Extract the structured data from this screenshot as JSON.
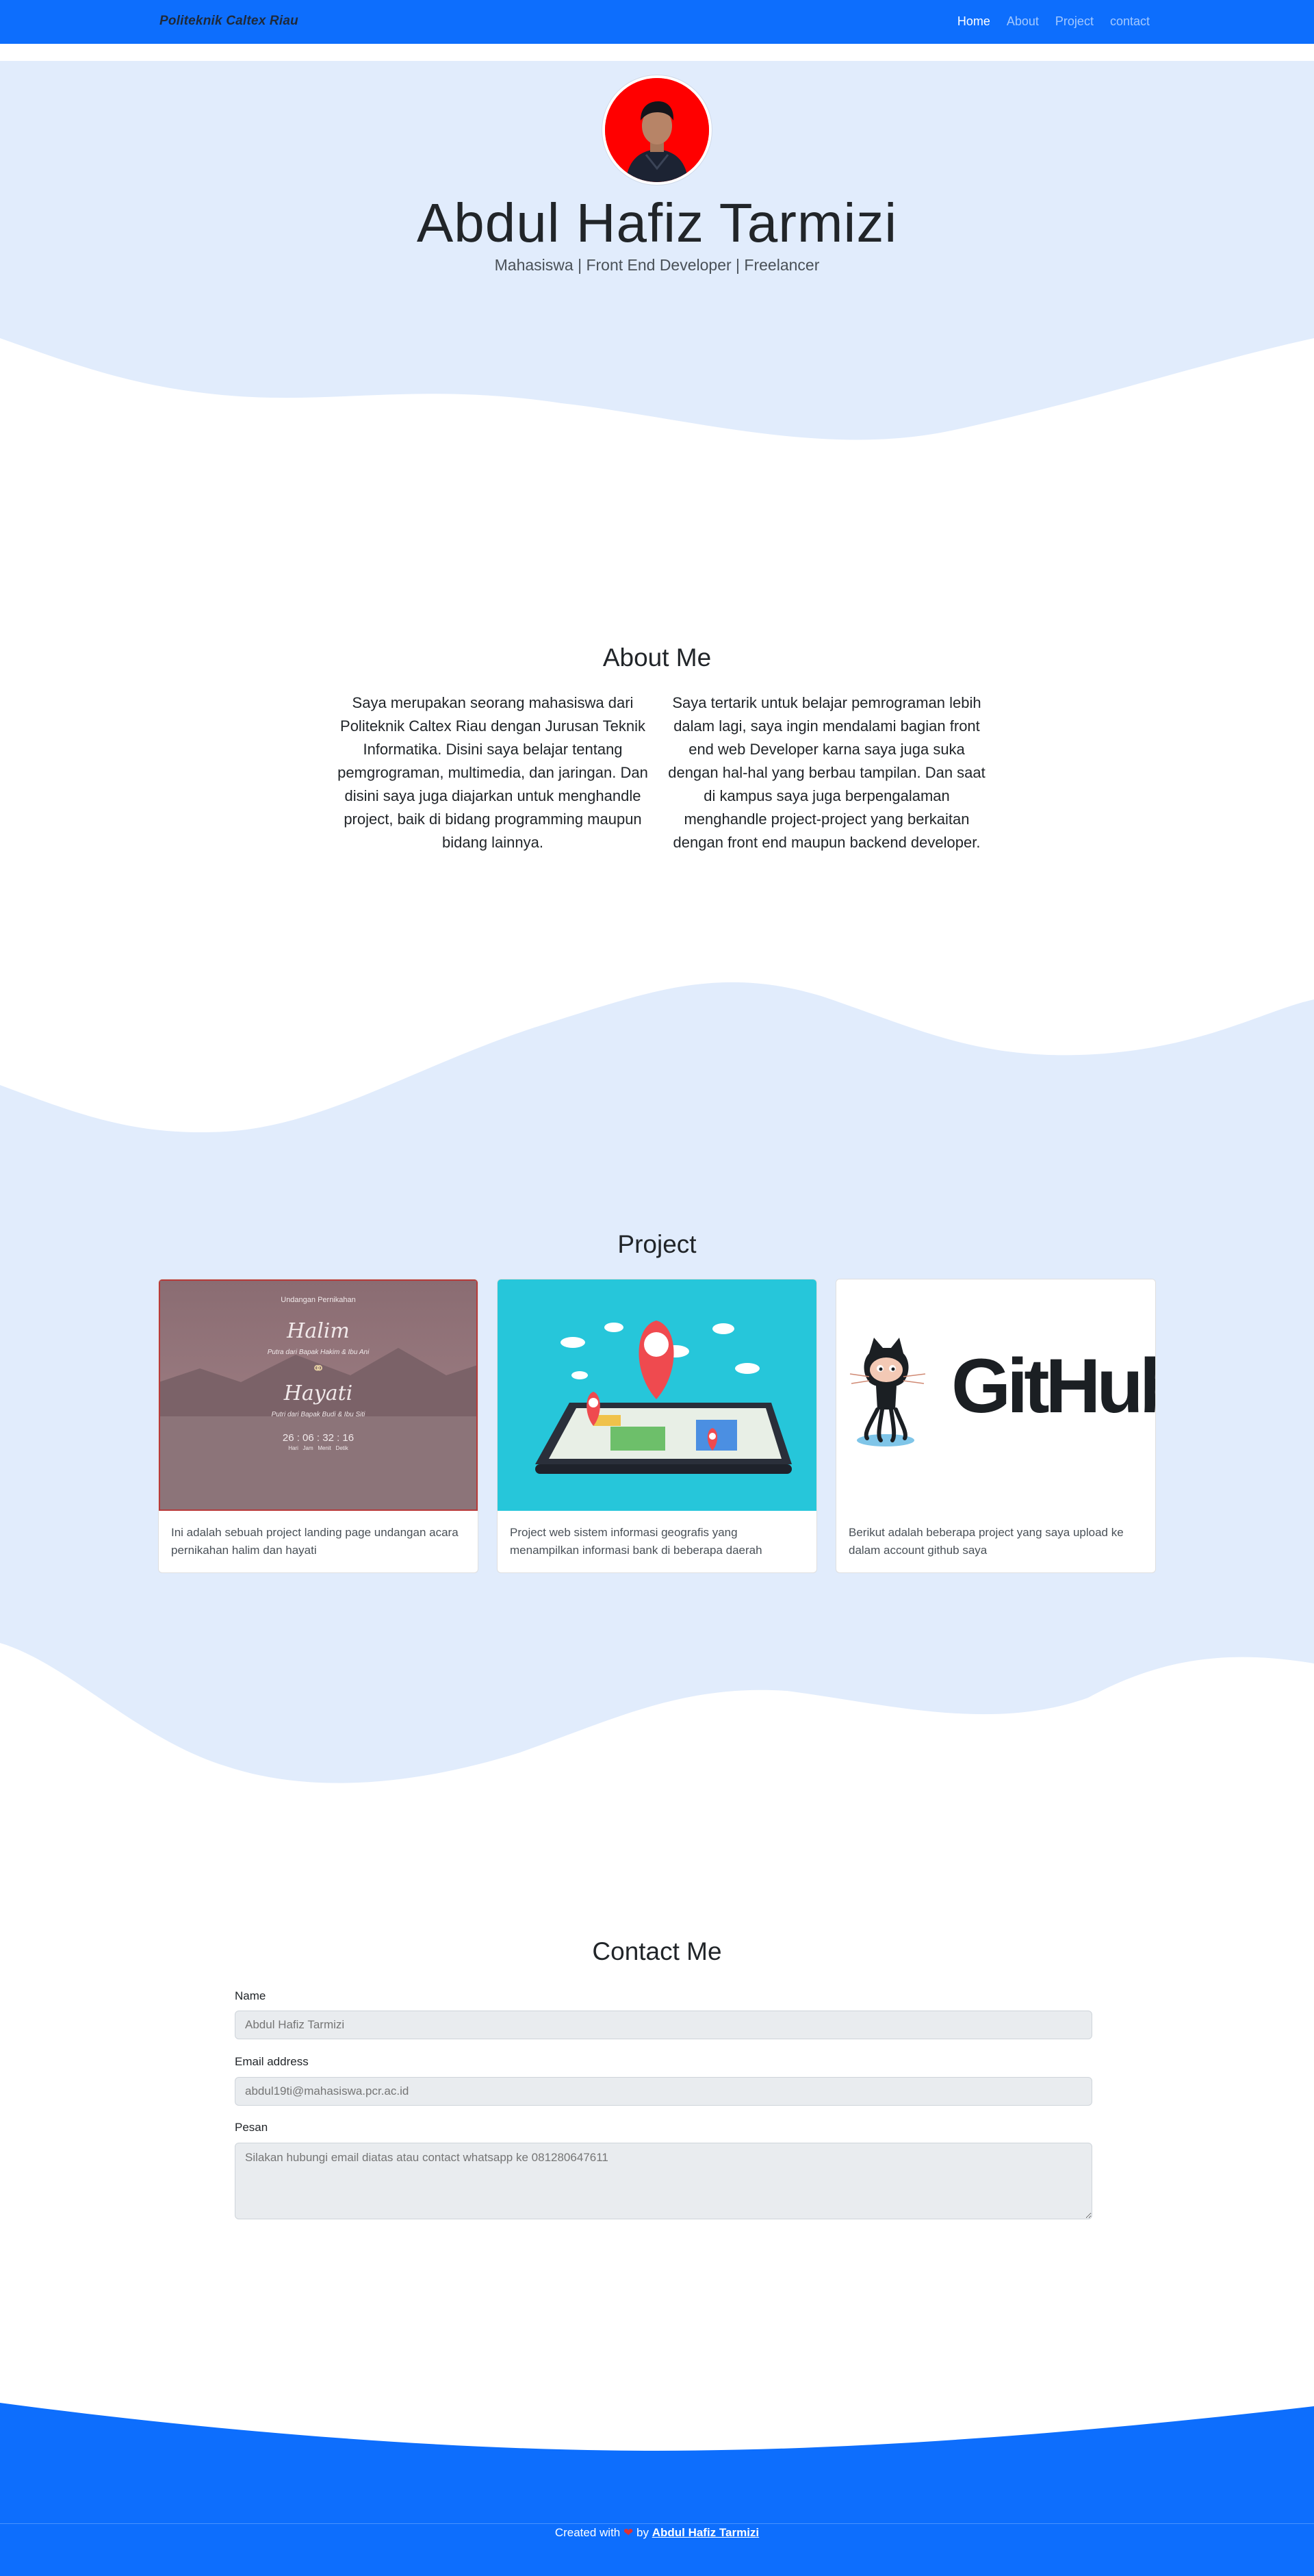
{
  "navbar": {
    "brand": "Politeknik Caltex Riau",
    "links": [
      {
        "label": "Home",
        "active": true
      },
      {
        "label": "About",
        "active": false
      },
      {
        "label": "Project",
        "active": false
      },
      {
        "label": "contact",
        "active": false
      }
    ]
  },
  "hero": {
    "name": "Abdul Hafiz Tarmizi",
    "subtitle": "Mahasiswa | Front End Developer | Freelancer"
  },
  "about": {
    "title": "About Me",
    "left_paragraph": "Saya merupakan seorang mahasiswa dari Politeknik Caltex Riau dengan Jurusan Teknik Informatika. Disini saya belajar tentang pemgrograman, multimedia, dan jaringan. Dan disini saya juga diajarkan untuk menghandle project, baik di bidang programming maupun bidang lainnya.",
    "right_paragraph": "Saya tertarik untuk belajar pemrograman lebih dalam lagi, saya ingin mendalami bagian front end web Developer karna saya juga suka dengan hal-hal yang berbau tampilan. Dan saat di kampus saya juga berpengalaman menghandle project-project yang berkaitan dengan front end maupun backend developer."
  },
  "project": {
    "title": "Project",
    "cards": [
      {
        "text": "Ini adalah sebuah project landing page undangan acara pernikahan halim dan hayati",
        "image": {
          "header": "Undangan Pernikahan",
          "groom": "Halim",
          "groom_parents": "Putra dari Bapak Hakim & Ibu Ani",
          "bride": "Hayati",
          "bride_parents": "Putri dari Bapak Budi & Ibu Siti",
          "countdown": "26 : 06 : 32 : 16",
          "countdown_units": "Hari   Jam   Menit   Detik"
        }
      },
      {
        "text": "Project web sistem informasi geografis yang menampilkan informasi bank di beberapa daerah"
      },
      {
        "text": "Berikut adalah beberapa project yang saya upload ke dalam account github saya",
        "logo_text": "GitHub"
      }
    ]
  },
  "contact": {
    "title": "Contact Me",
    "name_label": "Name",
    "name_placeholder": "Abdul Hafiz Tarmizi",
    "email_label": "Email address",
    "email_placeholder": "abdul19ti@mahasiswa.pcr.ac.id",
    "message_label": "Pesan",
    "message_placeholder": "Silakan hubungi email diatas atau contact whatsapp ke 081280647611"
  },
  "footer": {
    "prefix": "Created with",
    "heart": "❤",
    "by": "by",
    "author": "Abdul Hafiz Tarmizi"
  },
  "colors": {
    "primary": "#0d6efd",
    "hero_bg": "#e1ecfc",
    "avatar_bg": "#ff0000",
    "map_bg": "#26c6da"
  }
}
